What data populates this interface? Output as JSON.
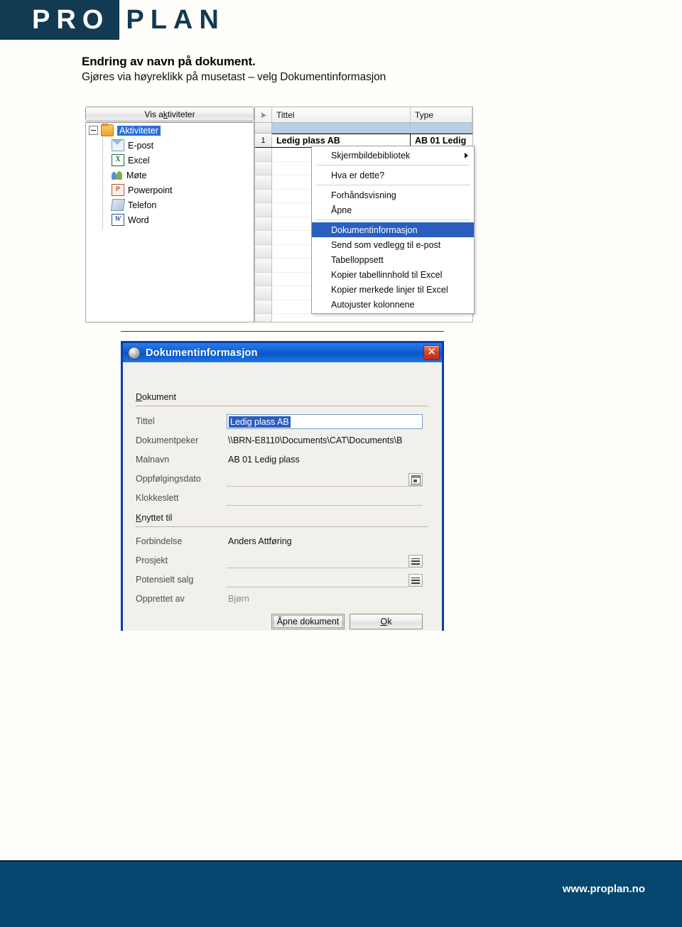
{
  "brand": {
    "logo_part1": "PRO",
    "logo_part2": "PLAN",
    "logo_box_color": "#123a52",
    "footer_bg": "#04466e",
    "footer_url": "www.proplan.no"
  },
  "page": {
    "title": "Endring av navn på dokument.",
    "subtitle": "Gjøres via høyreklikk på musetast – velg Dokumentinformasjon"
  },
  "tree_panel": {
    "button_label_a": "Vis a",
    "button_label_k": "k",
    "button_label_b": "tiviteter",
    "button_label_full": "Vis aktiviteter",
    "root": {
      "label": "Aktiviteter",
      "icon": "folder-icon",
      "selected": true
    },
    "items": [
      {
        "label": "E-post",
        "icon": "mail-icon"
      },
      {
        "label": "Excel",
        "icon": "excel-icon",
        "glyph": "X"
      },
      {
        "label": "Møte",
        "icon": "meeting-people-icon"
      },
      {
        "label": "Powerpoint",
        "icon": "powerpoint-icon",
        "glyph": "P"
      },
      {
        "label": "Telefon",
        "icon": "phone-icon"
      },
      {
        "label": "Word",
        "icon": "word-icon",
        "glyph": "W"
      }
    ]
  },
  "grid": {
    "columns": [
      "",
      "Tittel",
      "Type"
    ],
    "row_number": "1",
    "row": {
      "tittel": "Ledig plass AB",
      "type": "AB 01 Ledig"
    },
    "empty_rows": 13
  },
  "context_menu": {
    "items": [
      {
        "label": "Skjermbildebibliotek",
        "submenu": true,
        "selected": false
      },
      {
        "separator": true
      },
      {
        "label": "Hva er dette?",
        "submenu": false,
        "selected": false
      },
      {
        "separator": true
      },
      {
        "label": "Forhåndsvisning",
        "submenu": false,
        "selected": false
      },
      {
        "label": "Åpne",
        "submenu": false,
        "selected": false
      },
      {
        "separator": true
      },
      {
        "label": "Dokumentinformasjon",
        "submenu": false,
        "selected": true
      },
      {
        "label": "Send som vedlegg til e-post",
        "submenu": false,
        "selected": false
      },
      {
        "label": "Tabelloppsett",
        "submenu": false,
        "selected": false
      },
      {
        "label": "Kopier tabellinnhold til Excel",
        "submenu": false,
        "selected": false
      },
      {
        "label": "Kopier merkede linjer til Excel",
        "submenu": false,
        "selected": false
      },
      {
        "label": "Autojuster kolonnene",
        "submenu": false,
        "selected": false
      }
    ]
  },
  "dialog": {
    "title": "Dokumentinformasjon",
    "close_glyph": "✕",
    "section_dokument": "Dokument",
    "section_knyttet": "Knyttet til",
    "fields": {
      "tittel_label": "Tittel",
      "tittel_value": "Ledig plass AB",
      "dokumentpeker_label": "Dokumentpeker",
      "dokumentpeker_value": "\\\\BRN-E8110\\Documents\\CAT\\Documents\\B",
      "malnavn_label": "Malnavn",
      "malnavn_value": "AB 01 Ledig plass",
      "oppfolgingsdato_label": "Oppfølgingsdato",
      "oppfolgingsdato_value": "",
      "klokkeslett_label": "Klokkeslett",
      "klokkeslett_value": "",
      "forbindelse_label": "Forbindelse",
      "forbindelse_value": "Anders Attføring",
      "prosjekt_label": "Prosjekt",
      "prosjekt_value": "",
      "potensielt_salg_label": "Potensielt salg",
      "potensielt_salg_value": "",
      "opprettet_av_label": "Opprettet av",
      "opprettet_av_value": "Bjørn"
    },
    "buttons": {
      "open_document": "Åpne dokument",
      "ok": "Ok"
    }
  }
}
